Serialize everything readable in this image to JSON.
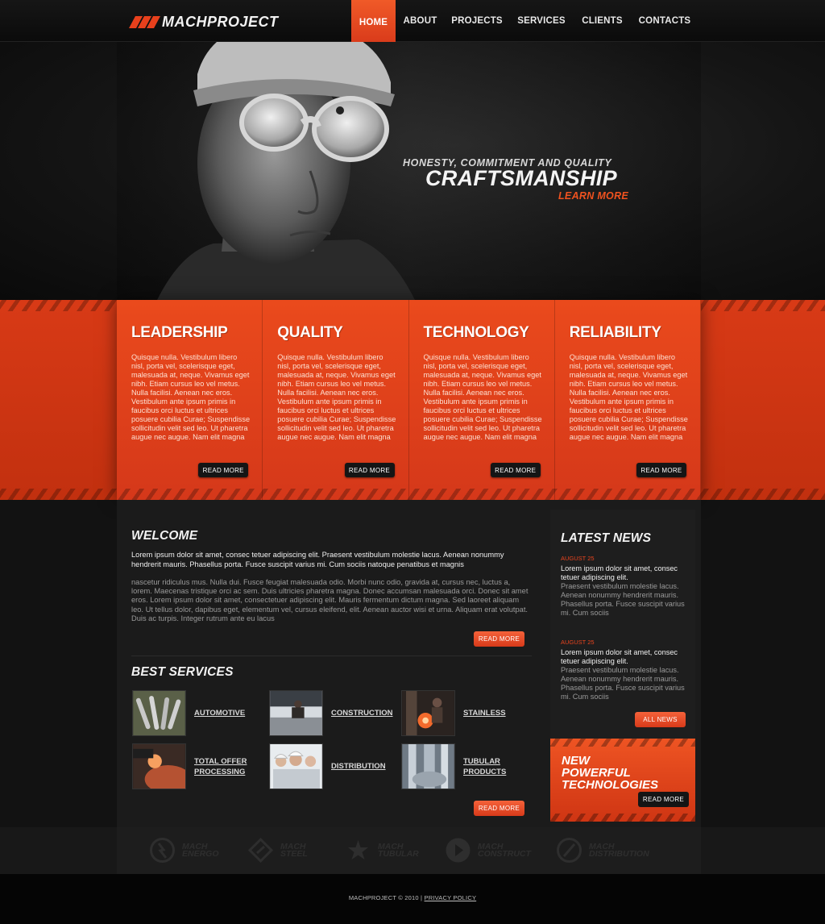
{
  "header": {
    "logo_text": "MACHPROJECT",
    "nav": [
      {
        "label": "HOME",
        "active": true
      },
      {
        "label": "ABOUT"
      },
      {
        "label": "PROJECTS"
      },
      {
        "label": "SERVICES"
      },
      {
        "label": "CLIENTS"
      },
      {
        "label": "CONTACTS"
      }
    ]
  },
  "hero": {
    "subtitle": "HONESTY, COMMITMENT AND QUALITY",
    "title": "CRAFTSMANSHIP",
    "cta": "LEARN MORE"
  },
  "features": [
    {
      "title": "LEADERSHIP",
      "text": "Quisque nulla. Vestibulum libero nisl, porta vel, scelerisque eget, malesuada at, neque. Vivamus eget nibh. Etiam cursus leo vel metus. Nulla facilisi. Aenean nec eros. Vestibulum ante ipsum primis in faucibus orci luctus et ultrices posuere cubilia Curae; Suspendisse sollicitudin velit sed leo. Ut pharetra augue nec augue. Nam elit magna",
      "button": "READ MORE"
    },
    {
      "title": "QUALITY",
      "text": "Quisque nulla. Vestibulum libero nisl, porta vel, scelerisque eget, malesuada at, neque. Vivamus eget nibh. Etiam cursus leo vel metus. Nulla facilisi. Aenean nec eros. Vestibulum ante ipsum primis in faucibus orci luctus et ultrices posuere cubilia Curae; Suspendisse sollicitudin velit sed leo. Ut pharetra augue nec augue. Nam elit magna",
      "button": "READ MORE"
    },
    {
      "title": "TECHNOLOGY",
      "text": "Quisque nulla. Vestibulum libero nisl, porta vel, scelerisque eget, malesuada at, neque. Vivamus eget nibh. Etiam cursus leo vel metus. Nulla facilisi. Aenean nec eros. Vestibulum ante ipsum primis in faucibus orci luctus et ultrices posuere cubilia Curae; Suspendisse sollicitudin velit sed leo. Ut pharetra augue nec augue. Nam elit magna",
      "button": "READ MORE"
    },
    {
      "title": "RELIABILITY",
      "text": "Quisque nulla. Vestibulum libero nisl, porta vel, scelerisque eget, malesuada at, neque. Vivamus eget nibh. Etiam cursus leo vel metus. Nulla facilisi. Aenean nec eros. Vestibulum ante ipsum primis in faucibus orci luctus et ultrices posuere cubilia Curae; Suspendisse sollicitudin velit sed leo. Ut pharetra augue nec augue. Nam elit magna",
      "button": "READ MORE"
    }
  ],
  "welcome": {
    "title": "WELCOME",
    "lead": "Lorem ipsum dolor sit amet, consec tetuer adipiscing elit. Praesent vestibulum molestie lacus. Aenean nonummy hendrerit mauris. Phasellus porta. Fusce suscipit varius mi. Cum sociis natoque penatibus et magnis",
    "body": "nascetur ridiculus mus. Nulla dui. Fusce feugiat malesuada odio. Morbi nunc odio, gravida at, cursus nec, luctus a, lorem. Maecenas tristique orci ac sem. Duis ultricies pharetra magna. Donec accumsan malesuada orci. Donec sit amet eros. Lorem ipsum dolor sit amet, consectetuer adipiscing elit. Mauris fermentum dictum magna. Sed laoreet aliquam leo. Ut tellus dolor, dapibus eget, elementum vel, cursus eleifend, elit. Aenean auctor wisi et urna. Aliquam erat volutpat. Duis ac turpis. Integer rutrum ante eu lacus",
    "button": "READ MORE"
  },
  "services": {
    "title": "BEST SERVICES",
    "items": [
      {
        "label": "AUTOMOTIVE",
        "icon": "wrench-tools-icon"
      },
      {
        "label": "CONSTRUCTION",
        "icon": "construction-worker-icon"
      },
      {
        "label": "STAINLESS",
        "icon": "welding-sparks-icon"
      },
      {
        "label": "TOTAL OFFER PROCESSING",
        "icon": "grinder-icon"
      },
      {
        "label": "DISTRIBUTION",
        "icon": "team-helmets-icon"
      },
      {
        "label": "TUBULAR PRODUCTS",
        "icon": "pipes-icon"
      }
    ],
    "button": "READ MORE"
  },
  "news": {
    "title": "LATEST NEWS",
    "items": [
      {
        "date": "AUGUST 25",
        "headline": "Lorem ipsum dolor sit amet, consec tetuer adipiscing elit.",
        "text": "Praesent vestibulum molestie lacus. Aenean nonummy hendrerit mauris. Phasellus porta. Fusce suscipit varius mi. Cum sociis"
      },
      {
        "date": "AUGUST 25",
        "headline": "Lorem ipsum dolor sit amet, consec tetuer adipiscing elit.",
        "text": "Praesent vestibulum molestie lacus. Aenean nonummy hendrerit mauris. Phasellus porta. Fusce suscipit varius mi. Cum sociis"
      }
    ],
    "button": "ALL NEWS"
  },
  "promo": {
    "line1": "NEW",
    "line2": "POWERFUL",
    "line3": "TECHNOLOGIES",
    "button": "READ MORE"
  },
  "brands": [
    {
      "line1": "MACH",
      "line2": "ENERGO",
      "icon": "energy-bolt-icon"
    },
    {
      "line1": "MACH",
      "line2": "STEEL",
      "icon": "steel-diamond-icon"
    },
    {
      "line1": "MACH",
      "line2": "TUBULAR",
      "icon": "star-swoosh-icon"
    },
    {
      "line1": "MACH",
      "line2": "CONSTRUCT",
      "icon": "play-circle-icon"
    },
    {
      "line1": "MACH",
      "line2": "DISTRIBUTION",
      "icon": "slash-circle-icon"
    }
  ],
  "footer": {
    "copyright": "MACHPROJECT © 2010 |",
    "privacy": "PRIVACY POLICY"
  },
  "colors": {
    "accent": "#e8401c",
    "dark": "#151515"
  }
}
